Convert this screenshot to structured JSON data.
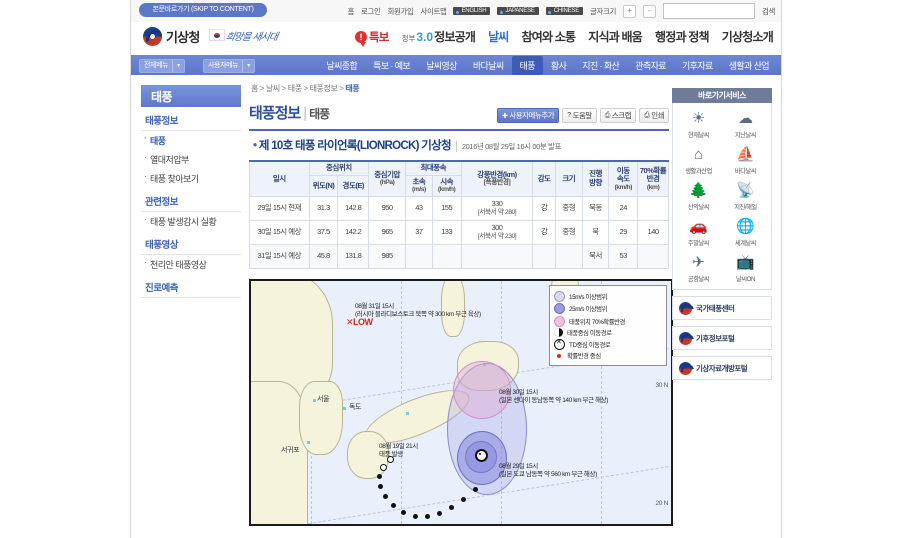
{
  "utility": {
    "skip_link": "본문바로가기 (SKIP TO CONTENT)",
    "links": [
      "홈",
      "로그인",
      "회원가입",
      "사이트맵"
    ],
    "languages": [
      "ENGLISH",
      "JAPANESE",
      "CHINESE"
    ],
    "fontsize_label": "글자크기",
    "fontsize_plus": "+",
    "fontsize_minus": "-",
    "search_placeholder": "",
    "search_value": "",
    "search_button": "검색"
  },
  "header": {
    "logo_text": "기상청",
    "slogan": "희망을 새시대",
    "alert_label": "특보",
    "gov_prefix": "정부",
    "gov_number": "3.0",
    "gov_label": "정보공개",
    "nav": [
      "날씨",
      "참여와 소통",
      "지식과 배움",
      "행정과 정책",
      "기상청소개"
    ]
  },
  "subnav": {
    "all_menu": "전체메뉴",
    "user_menu": "사용자메뉴",
    "items": [
      {
        "label": "날씨종합",
        "active": false
      },
      {
        "label": "특보 · 예보",
        "active": false
      },
      {
        "label": "날씨영상",
        "active": false
      },
      {
        "label": "바다날씨",
        "active": false
      },
      {
        "label": "태풍",
        "active": true
      },
      {
        "label": "황사",
        "active": false
      },
      {
        "label": "지진 · 화산",
        "active": false
      },
      {
        "label": "관측자료",
        "active": false
      },
      {
        "label": "기후자료",
        "active": false
      },
      {
        "label": "생활과 산업",
        "active": false
      }
    ]
  },
  "sidebar": {
    "title": "태풍",
    "groups": [
      {
        "label": "태풍정보",
        "items": [
          {
            "label": "태풍",
            "active": true
          },
          {
            "label": "열대저압부",
            "active": false
          },
          {
            "label": "태풍 찾아보기",
            "active": false
          }
        ]
      },
      {
        "label": "관련정보",
        "items": [
          {
            "label": "태풍 발생감시 실황",
            "active": false
          }
        ]
      },
      {
        "label": "태풍영상",
        "items": [
          {
            "label": "천리안 태풍영상",
            "active": false
          }
        ]
      },
      {
        "label": "진로예측",
        "items": []
      }
    ]
  },
  "main": {
    "breadcrumb": [
      "홈",
      "날씨",
      "태풍",
      "태풍정보",
      "태풍"
    ],
    "breadcrumb_current": "태풍",
    "page_title": "태풍정보",
    "page_subtitle": "태풍",
    "buttons": [
      {
        "label": "사용자메뉴추가",
        "icon": "plus-icon",
        "primary": true
      },
      {
        "label": "도움말",
        "icon": "question-icon",
        "primary": false
      },
      {
        "label": "스크랩",
        "icon": "scrap-icon",
        "primary": false
      },
      {
        "label": "인쇄",
        "icon": "print-icon",
        "primary": false
      }
    ],
    "storm_title": "제 10호 태풍 라이언록(LIONROCK) 기상청",
    "storm_meta": "2016년 08월 29일 16시 00분 발표"
  },
  "table": {
    "headers": {
      "datetime": "일시",
      "center_position": "중심위치",
      "latitude": "위도(N)",
      "longitude": "경도(E)",
      "pressure": "중심기압",
      "pressure_unit": "(hPa)",
      "max_wind": "최대풍속",
      "wind_ms": "초속",
      "wind_ms_unit": "(m/s)",
      "wind_kmh": "시속",
      "wind_kmh_unit": "(km/h)",
      "strong_wind_radius": "강풍반경(km)",
      "storm_radius": "[폭풍반경]",
      "intensity": "강도",
      "size": "크기",
      "direction": "진행",
      "direction2": "방향",
      "speed": "이동",
      "speed2": "속도",
      "speed_unit": "(km/h)",
      "probability": "70%확률",
      "probability2": "반경",
      "probability_unit": "(km)"
    },
    "rows": [
      {
        "datetime": "29일 15시 현재",
        "lat": "31.3",
        "lon": "142.8",
        "pressure": "950",
        "wind_ms": "43",
        "wind_kmh": "155",
        "radius": "330",
        "radius_sub": "[서북서 약 280]",
        "intensity": "강",
        "size": "중형",
        "direction": "북동",
        "speed": "24",
        "probability": ""
      },
      {
        "datetime": "30일 15시 예상",
        "lat": "37.5",
        "lon": "142.2",
        "pressure": "965",
        "wind_ms": "37",
        "wind_kmh": "133",
        "radius": "300",
        "radius_sub": "[서북서 약 230]",
        "intensity": "강",
        "size": "중형",
        "direction": "북",
        "speed": "29",
        "probability": "140"
      },
      {
        "datetime": "31일 15시 예상",
        "lat": "45.8",
        "lon": "131.8",
        "pressure": "985",
        "wind_ms": "",
        "wind_kmh": "",
        "radius": "",
        "radius_sub": "",
        "intensity": "",
        "size": "",
        "direction": "북서",
        "speed": "53",
        "probability": ""
      }
    ]
  },
  "map": {
    "legend": [
      {
        "label": "15m/s 이상범위",
        "swatch": "a"
      },
      {
        "label": "25m/s 이상범위",
        "swatch": "b"
      },
      {
        "label": "태풍위치 70%확률반경",
        "swatch": "c"
      },
      {
        "label": "태풍중심 이동경로",
        "swatch": "d"
      },
      {
        "label": "TD중심 이동경로",
        "swatch": "e"
      },
      {
        "label": "확률반경 중심",
        "swatch": "f"
      }
    ],
    "annotations": [
      {
        "line1": "08월 31일 15시",
        "line2": "(러시아 블라디보스토크 북쪽 약 300 km 부근 육상)"
      },
      {
        "line1": "08월 30일 15시",
        "line2": "(일본 센다이 동남동쪽 약 140 km 부근 해상)"
      },
      {
        "line1": "08월 29일 15시",
        "line2": "(일본 도쿄 남동쪽 약 560 km 부근 해상)"
      }
    ],
    "genesis_label_1": "08월 19일 21시",
    "genesis_label_2": "태풍 발생",
    "low_marker": "✕LOW",
    "city_labels": [
      "서울",
      "독도",
      "서귀포"
    ],
    "lat_labels": [
      "30 N",
      "20 N"
    ]
  },
  "quick": {
    "title": "바로가기서비스",
    "items": [
      {
        "label": "현재날씨",
        "icon": "sun-icon",
        "glyph": "☀"
      },
      {
        "label": "지난날씨",
        "icon": "cloud-icon",
        "glyph": "☁"
      },
      {
        "label": "생활과산업",
        "icon": "house-icon",
        "glyph": "⌂"
      },
      {
        "label": "바다날씨",
        "icon": "ship-icon",
        "glyph": "⛵"
      },
      {
        "label": "산악날씨",
        "icon": "tree-icon",
        "glyph": "🌲"
      },
      {
        "label": "지진/해일",
        "icon": "seismic-icon",
        "glyph": "📡"
      },
      {
        "label": "주말날씨",
        "icon": "car-icon",
        "glyph": "🚗"
      },
      {
        "label": "세계날씨",
        "icon": "globe-icon",
        "glyph": "🌐"
      },
      {
        "label": "공항날씨",
        "icon": "plane-icon",
        "glyph": "✈"
      },
      {
        "label": "날씨ON",
        "icon": "tv-icon",
        "glyph": "📺"
      }
    ],
    "banners": [
      {
        "label": "국가태풍센터"
      },
      {
        "label": "기후정보포털"
      },
      {
        "label": "기상자료개방포털"
      }
    ]
  }
}
